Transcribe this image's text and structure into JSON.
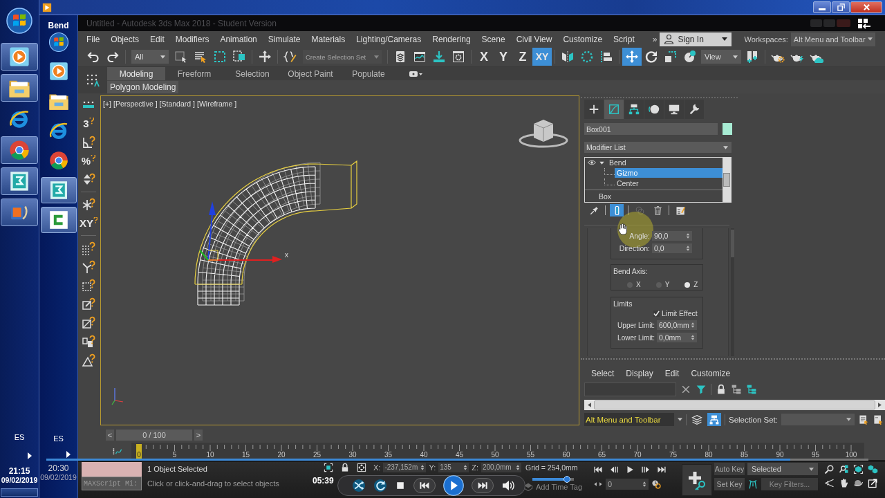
{
  "outer_taskbar": {
    "apps": [
      {
        "running": true
      },
      {
        "running": true
      },
      {
        "running": false
      },
      {
        "running": true
      },
      {
        "running": true
      },
      {
        "running": true
      }
    ],
    "language": "ES",
    "time": "21:15",
    "date": "09/02/2019"
  },
  "inner_taskbar": {
    "caption": "Bend",
    "apps": [
      {
        "running": false
      },
      {
        "running": false
      },
      {
        "running": false
      },
      {
        "running": false
      },
      {
        "running": true
      },
      {
        "running": true
      }
    ],
    "language": "ES",
    "time": "20:30",
    "date": "09/02/2019"
  },
  "video_player": {
    "elapsed": "05:39",
    "seek": {
      "level": 0.905
    },
    "volume": {
      "level": 0.92
    }
  },
  "window": {
    "title": "Untitled - Autodesk 3ds Max 2018 - Student Version"
  },
  "menu": {
    "items": [
      "File",
      "Objects",
      "Edit",
      "Modifiers",
      "Animation",
      "Simulate",
      "Materials",
      "Lighting/Cameras",
      "Rendering",
      "Scene",
      "Civil View",
      "Customize",
      "Script"
    ],
    "overflow": "»",
    "sign_in": "Sign In",
    "workspaces_label": "Workspaces:",
    "workspace": "Alt Menu and Toolbar"
  },
  "toolbar": {
    "selection_filter": "All",
    "selection_set": {
      "placeholder": "Create Selection Set",
      "disabled": true
    },
    "axis_constraints": [
      {
        "label": "X",
        "selected": false
      },
      {
        "label": "Y",
        "selected": false
      },
      {
        "label": "Z",
        "selected": false
      },
      {
        "label": "XY",
        "selected": true
      }
    ],
    "transform_tools": [
      {
        "selected": true
      },
      {
        "selected": false
      },
      {
        "selected": false
      },
      {
        "selected": false
      }
    ],
    "reference_coordinate": "View"
  },
  "ribbon": {
    "tabs": [
      {
        "label": "Modeling",
        "selected": true
      },
      {
        "label": "Freeform",
        "selected": false
      },
      {
        "label": "Selection",
        "selected": false
      },
      {
        "label": "Object Paint",
        "selected": false
      },
      {
        "label": "Populate",
        "selected": false
      }
    ],
    "panel": "Polygon Modeling"
  },
  "left_toolbar": [
    {
      "kind": "icon"
    },
    {
      "kind": "glyph",
      "text": "3"
    },
    {
      "kind": "icon"
    },
    {
      "kind": "glyph",
      "text": "%"
    },
    {
      "kind": "icon"
    },
    {
      "kind": "icon"
    },
    {
      "kind": "glyph",
      "text": "XY"
    },
    {
      "kind": "icon"
    },
    {
      "kind": "icon"
    },
    {
      "kind": "icon"
    },
    {
      "kind": "icon"
    },
    {
      "kind": "icon"
    },
    {
      "kind": "icon"
    },
    {
      "kind": "icon"
    }
  ],
  "viewport": {
    "active": true,
    "labels": [
      "[+]",
      "[Perspective ]",
      "[Standard ]",
      "[Wireframe ]"
    ],
    "gizmo_axis_label": "x"
  },
  "command_panel": {
    "tabs": [
      {
        "selected": false
      },
      {
        "selected": true
      },
      {
        "selected": false
      },
      {
        "selected": false
      },
      {
        "selected": false
      },
      {
        "selected": false
      }
    ],
    "object_name": "Box001",
    "modifier_list": "Modifier List",
    "modifier_stack": [
      {
        "kind": "modifier",
        "name": "Bend",
        "enabled": true,
        "expanded": true,
        "selected": false,
        "children": [
          {
            "name": "Gizmo",
            "selected": true
          },
          {
            "name": "Center",
            "selected": false
          }
        ]
      },
      {
        "kind": "base_object",
        "name": "Box",
        "selected": false
      }
    ],
    "stack_tools": [
      {
        "selected": false,
        "disabled": false
      },
      {
        "selected": true,
        "disabled": false
      },
      {
        "selected": false,
        "disabled": true
      },
      {
        "selected": false,
        "disabled": false
      },
      {
        "selected": false,
        "disabled": false
      }
    ],
    "parameters": {
      "fields": [
        {
          "label": "Angle:",
          "value": "90,0"
        },
        {
          "label": "Direction:",
          "value": "0,0"
        }
      ],
      "bend_axis": {
        "title": "Bend Axis:",
        "options": [
          {
            "label": "X",
            "selected": false
          },
          {
            "label": "Y",
            "selected": false
          },
          {
            "label": "Z",
            "selected": true
          }
        ]
      },
      "limits": {
        "title": "Limits",
        "limit_effect": {
          "label": "Limit Effect",
          "checked": true
        },
        "fields": [
          {
            "label": "Upper Limit:",
            "value": "600,0mm"
          },
          {
            "label": "Lower Limit:",
            "value": "0,0mm"
          }
        ]
      }
    }
  },
  "scene_explorer": {
    "menu": [
      "Select",
      "Display",
      "Edit",
      "Customize"
    ]
  },
  "workspace_bar": {
    "workspace": "Alt Menu and Toolbar",
    "tools": [
      {
        "selected": false
      },
      {
        "selected": true
      }
    ],
    "selection_set_label": "Selection Set:"
  },
  "time_slider": {
    "previous": "<",
    "position": "0 / 100",
    "next": ">"
  },
  "track_bar": {
    "labels": [
      "0",
      "5",
      "10",
      "15",
      "20",
      "25",
      "30",
      "35",
      "40",
      "45",
      "50",
      "55",
      "60",
      "65",
      "70",
      "75",
      "80",
      "85",
      "90",
      "95",
      "100"
    ]
  },
  "status_bar": {
    "script_listener": "MAXScript Mi:",
    "selection_info": "1 Object Selected",
    "prompt": "Click or click-and-drag to select objects",
    "coordinates": [
      {
        "axis": "X:",
        "value": "-237,152m"
      },
      {
        "axis": "Y:",
        "value": "135"
      },
      {
        "axis": "Z:",
        "value": "200,0mm"
      }
    ],
    "grid": "Grid = 254,0mm",
    "time_tag": "Add Time Tag"
  },
  "animation_controls": {
    "frame": "0",
    "auto_key": "Auto Key",
    "key_target": "Selected",
    "set_key": "Set Key",
    "key_filters": "Key Filters..."
  }
}
